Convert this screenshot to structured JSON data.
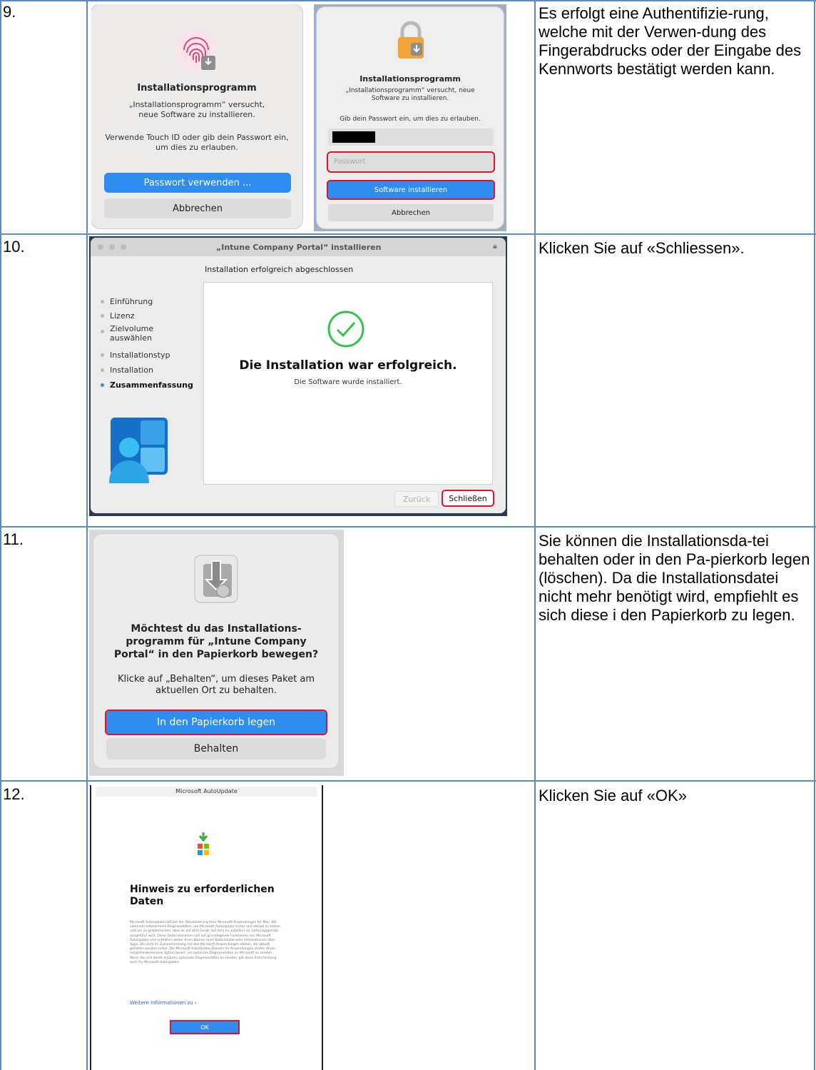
{
  "steps": [
    {
      "number": "9.",
      "description": "Es erfolgt eine Authentifizie-rung, welche mit der Verwen-dung des Fingerabdrucks oder der Eingabe des Kennworts bestätigt werden kann.",
      "touchid_dialog": {
        "title": "Installationsprogramm",
        "message": "„Installationsprogramm“ versucht, neue Software zu installieren.",
        "instruction": "Verwende Touch ID oder gib dein Passwort ein, um dies zu erlauben.",
        "primary_button": "Passwort verwenden ...",
        "secondary_button": "Abbrechen"
      },
      "password_dialog": {
        "title": "Installationsprogramm",
        "message": "„Installationsprogramm“ versucht, neue Software zu installieren.",
        "instruction": "Gib dein Passwort ein, um dies zu erlauben.",
        "password_placeholder": "Passwort",
        "primary_button": "Software installieren",
        "secondary_button": "Abbrechen"
      }
    },
    {
      "number": "10.",
      "description": "Klicken Sie auf «Schliessen».",
      "installer_window": {
        "title": "„Intune Company Portal“ installieren",
        "subtitle": "Installation erfolgreich abgeschlossen",
        "sidebar": [
          "Einführung",
          "Lizenz",
          "Zielvolume auswählen",
          "Installationstyp",
          "Installation",
          "Zusammenfassung"
        ],
        "success_heading": "Die Installation war erfolgreich.",
        "success_text": "Die Software wurde installiert.",
        "back_button": "Zurück",
        "close_button": "Schließen"
      }
    },
    {
      "number": "11.",
      "description": "Sie können die Installationsda-tei behalten oder in den Pa-pierkorb legen (löschen). Da die Installationsdatei nicht mehr benötigt wird, empfiehlt es sich diese i den Papierkorb zu legen.",
      "trash_dialog": {
        "title": "Möchtest du das Installations-programm für „Intune Company Portal“ in den Papierkorb bewegen?",
        "message": "Klicke auf „Behalten“, um dieses Paket am aktuellen Ort zu behalten.",
        "primary_button": "In den Papierkorb legen",
        "secondary_button": "Behalten"
      }
    },
    {
      "number": "12.",
      "description": "Klicken Sie auf «OK»",
      "autoupdate_window": {
        "title": "Microsoft AutoUpdate",
        "heading": "Hinweis zu erforderlichen Daten",
        "body": "Microsoft AutoUpdate hilft bei der Aktualisierung Ihrer Microsoft-Anwendungen für Mac. Wir sammeln erforderliche Diagnosedaten, um Microsoft AutoUpdate sicher und aktuell zu halten und um zu gewährleisten, dass es auf dem Gerät, auf dem es installiert ist, ordnungsgemäß ausgeführt wird. Diese Daten beziehen sich auf grundlegende Funktionen von Microsoft AutoUpdate und enthalten weder Ihren Namen noch Dateiinhalte oder Informationen über Apps, die nicht im Zusammenhang mit den Microsoft-Anwendungen stehen, die aktuell gehalten werden sollen. Die Microsoft AutoUpdate-Dienste für Anwendungen stellen Ihnen möglicherweise eine Option bereit, um optionale Diagnosedaten an Microsoft zu senden. Wenn Sie sich bereit erklären, optionale Diagnosedaten zu senden, gilt diese Entscheidung auch für Microsoft AutoUpdate.",
        "link": "Weitere Informationen zu",
        "ok_button": "OK"
      }
    }
  ]
}
